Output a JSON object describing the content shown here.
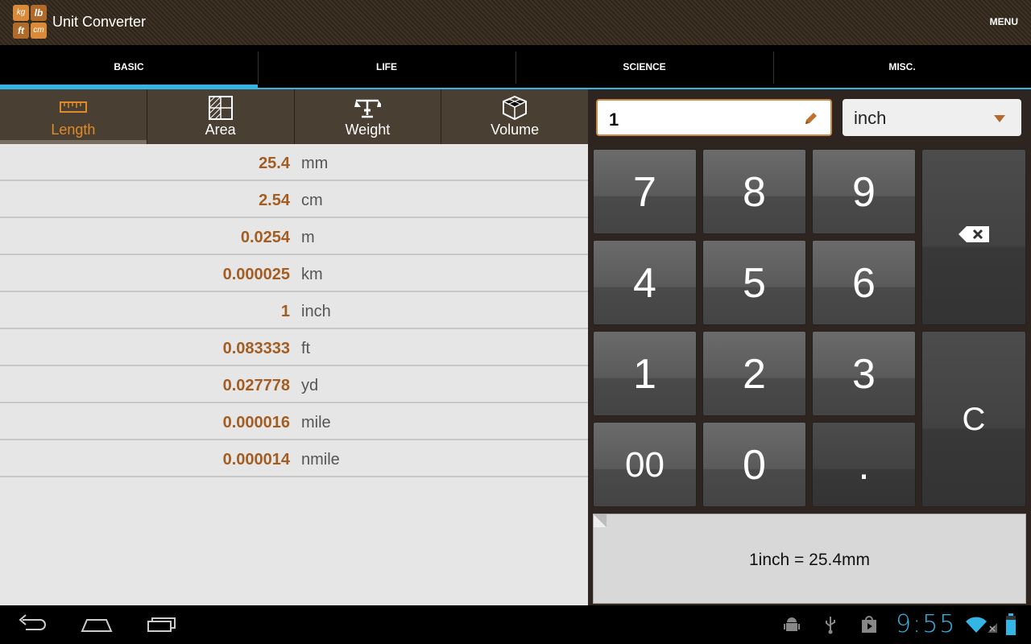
{
  "actionbar": {
    "title": "Unit Converter",
    "menu_label": "MENU",
    "icon_letters": [
      "kg",
      "lb",
      "ft",
      "cm"
    ]
  },
  "tabs": [
    {
      "label": "BASIC",
      "active": true
    },
    {
      "label": "LIFE",
      "active": false
    },
    {
      "label": "SCIENCE",
      "active": false
    },
    {
      "label": "MISC.",
      "active": false
    }
  ],
  "categories": [
    {
      "label": "Length",
      "icon": "ruler-icon",
      "active": true
    },
    {
      "label": "Area",
      "icon": "area-grid-icon",
      "active": false
    },
    {
      "label": "Weight",
      "icon": "scale-icon",
      "active": false
    },
    {
      "label": "Volume",
      "icon": "cube-icon",
      "active": false
    }
  ],
  "results": [
    {
      "value": "25.4",
      "unit": "mm"
    },
    {
      "value": "2.54",
      "unit": "cm"
    },
    {
      "value": "0.0254",
      "unit": "m"
    },
    {
      "value": "0.000025",
      "unit": "km"
    },
    {
      "value": "1",
      "unit": "inch"
    },
    {
      "value": "0.083333",
      "unit": "ft"
    },
    {
      "value": "0.027778",
      "unit": "yd"
    },
    {
      "value": "0.000016",
      "unit": "mile"
    },
    {
      "value": "0.000014",
      "unit": "nmile"
    }
  ],
  "input": {
    "value": "1",
    "unit": "inch"
  },
  "keypad": {
    "k7": "7",
    "k8": "8",
    "k9": "9",
    "k4": "4",
    "k5": "5",
    "k6": "6",
    "k1": "1",
    "k2": "2",
    "k3": "3",
    "k00": "00",
    "k0": "0",
    "kdot": ".",
    "clear": "C"
  },
  "summary": "1inch = 25.4mm",
  "statusbar": {
    "time": "9:55"
  },
  "colors": {
    "accent": "#33b5e5",
    "value": "#a35d22",
    "active_category": "#e08a28"
  }
}
